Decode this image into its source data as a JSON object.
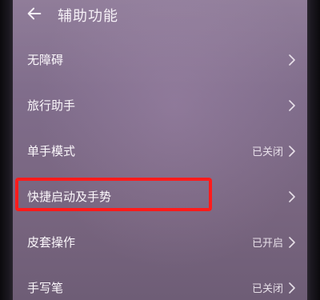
{
  "header": {
    "title": "辅助功能"
  },
  "rows": [
    {
      "label": "无障碍",
      "status": ""
    },
    {
      "label": "旅行助手",
      "status": ""
    },
    {
      "label": "单手模式",
      "status": "已关闭"
    },
    {
      "label": "快捷启动及手势",
      "status": ""
    },
    {
      "label": "皮套操作",
      "status": "已开启"
    },
    {
      "label": "手写笔",
      "status": "已关闭"
    }
  ],
  "colors": {
    "screen_bg": "#7f6c8a",
    "text": "#fbf7fb",
    "highlight": "#ff1b1b"
  }
}
